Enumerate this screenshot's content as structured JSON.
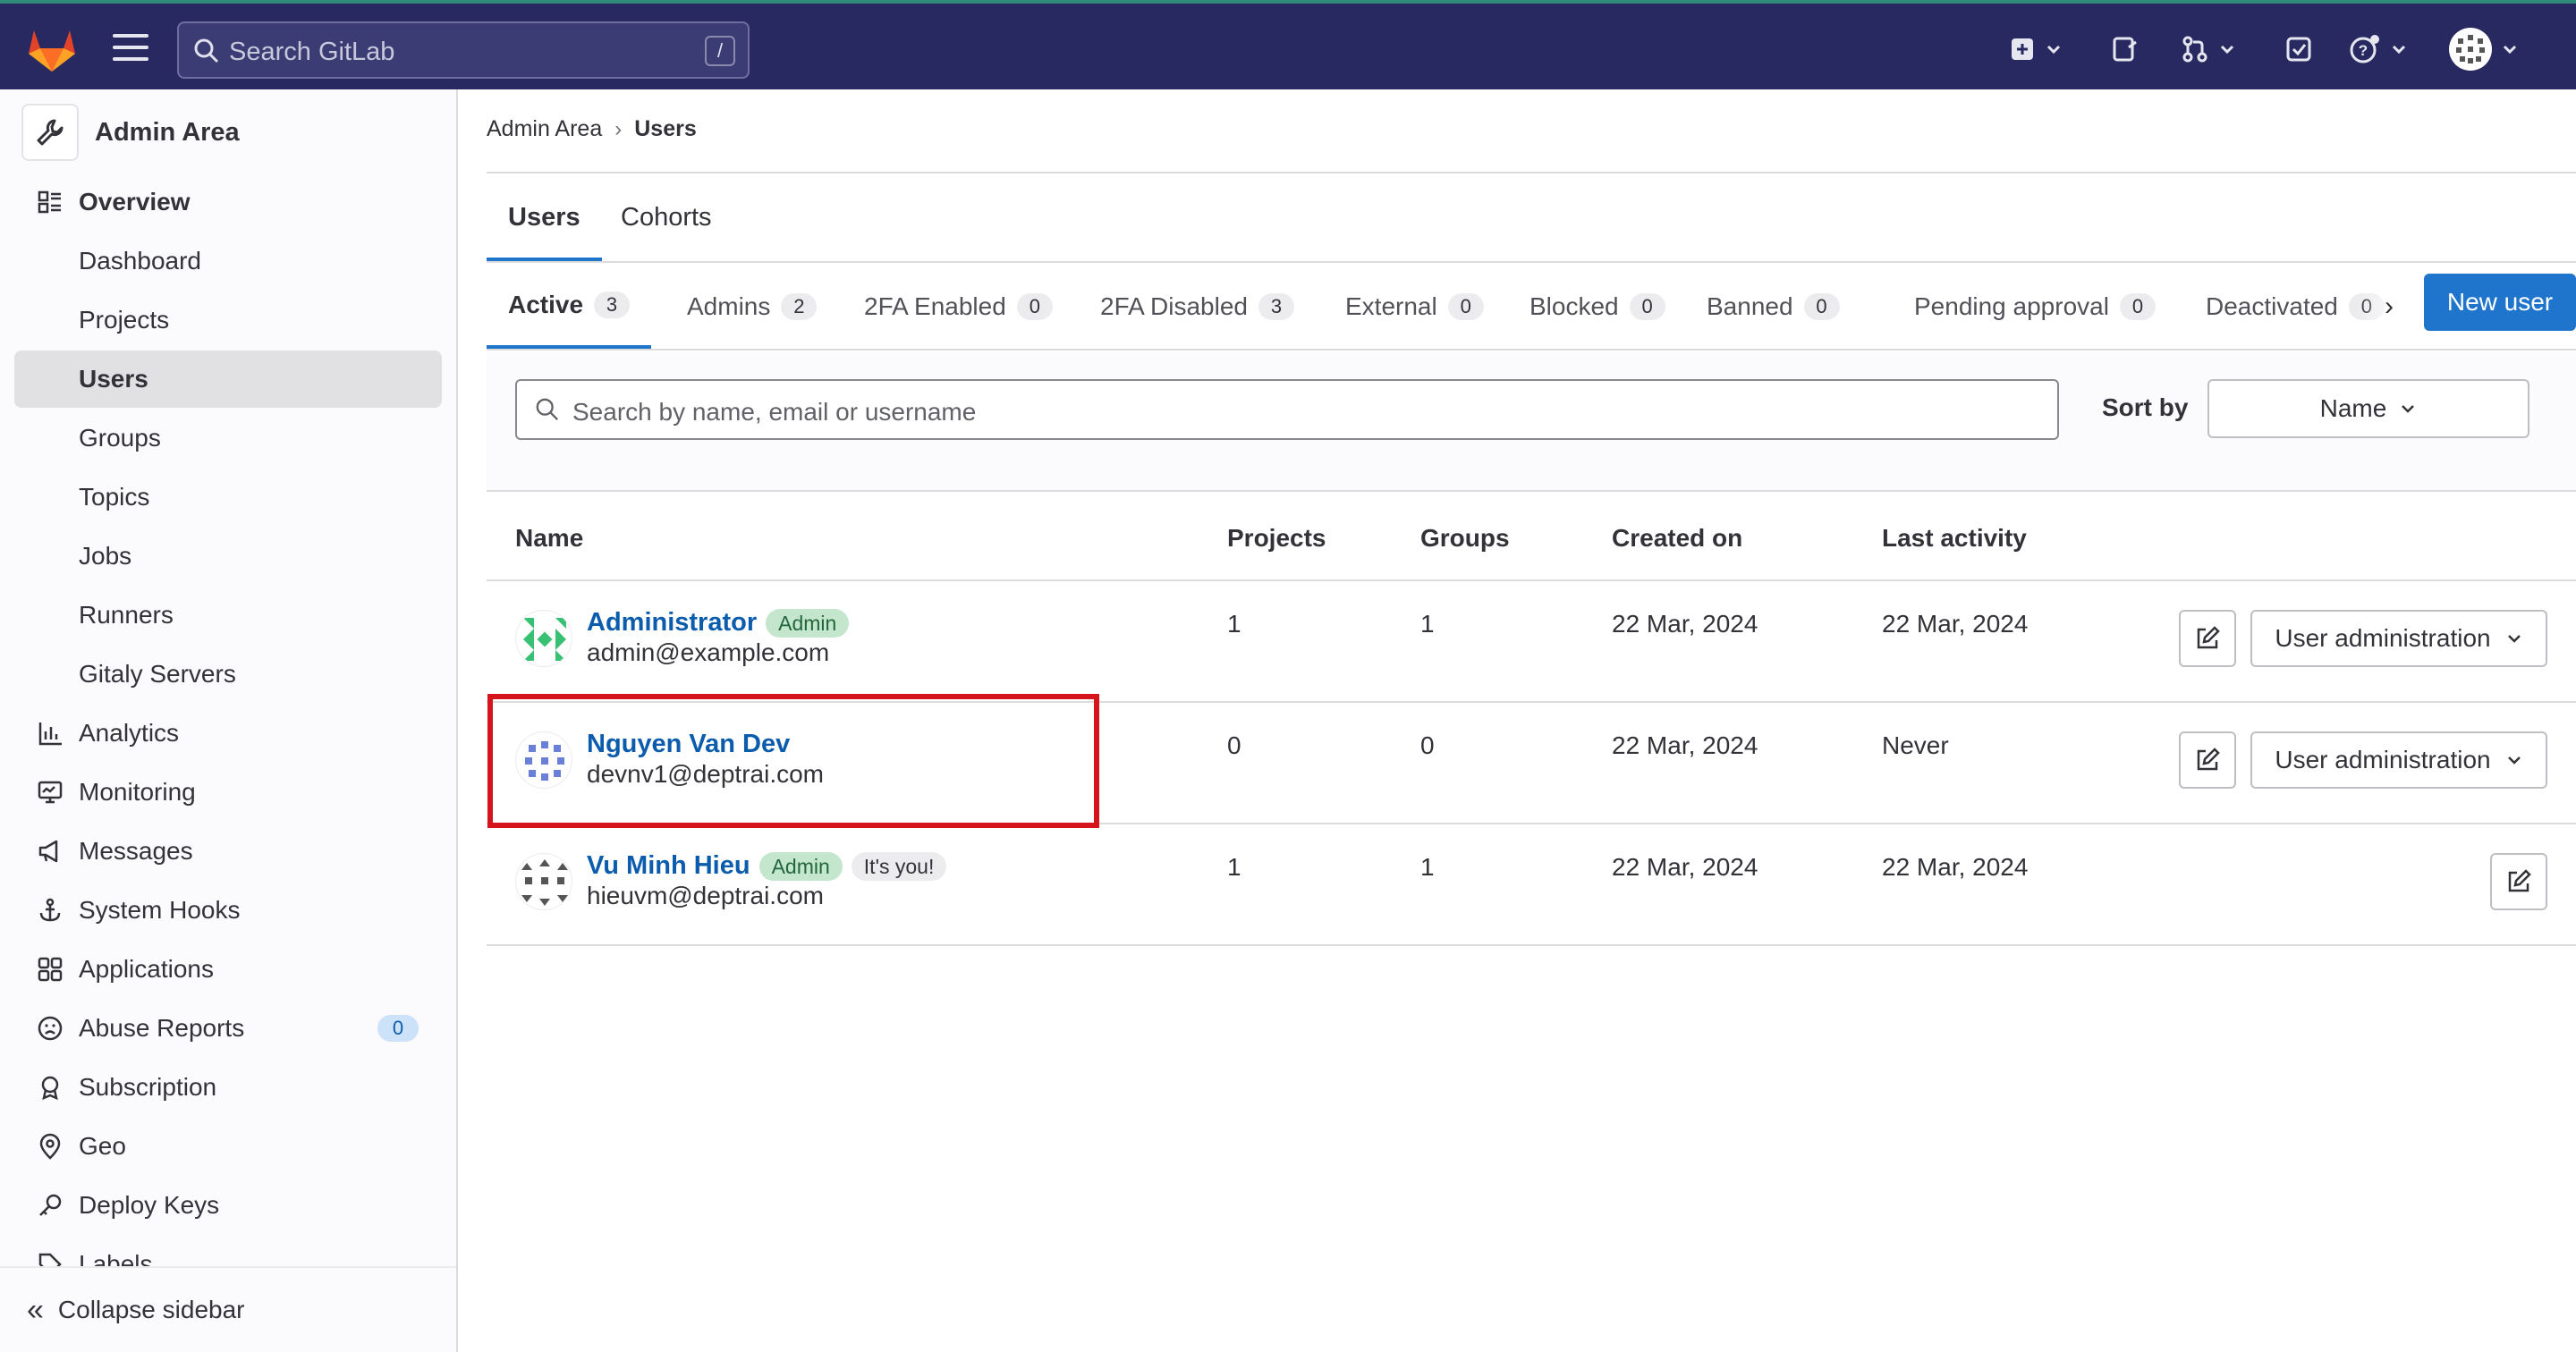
{
  "navbar": {
    "search_placeholder": "Search GitLab",
    "search_shortcut": "/",
    "icons": [
      "gitlab-logo",
      "hamburger-icon",
      "search-icon",
      "new-item-icon",
      "issues-icon",
      "merge-requests-icon",
      "todos-icon",
      "help-icon",
      "user-avatar"
    ]
  },
  "sidebar": {
    "title": "Admin Area",
    "items": [
      {
        "label": "Overview",
        "icon": "overview-icon"
      },
      {
        "label": "Dashboard"
      },
      {
        "label": "Projects"
      },
      {
        "label": "Users"
      },
      {
        "label": "Groups"
      },
      {
        "label": "Topics"
      },
      {
        "label": "Jobs"
      },
      {
        "label": "Runners"
      },
      {
        "label": "Gitaly Servers"
      },
      {
        "label": "Analytics",
        "icon": "analytics-icon"
      },
      {
        "label": "Monitoring",
        "icon": "monitoring-icon"
      },
      {
        "label": "Messages",
        "icon": "messages-icon"
      },
      {
        "label": "System Hooks",
        "icon": "hooks-icon"
      },
      {
        "label": "Applications",
        "icon": "applications-icon"
      },
      {
        "label": "Abuse Reports",
        "icon": "abuse-icon",
        "count": "0"
      },
      {
        "label": "Subscription",
        "icon": "subscription-icon"
      },
      {
        "label": "Geo",
        "icon": "geo-icon"
      },
      {
        "label": "Deploy Keys",
        "icon": "key-icon"
      },
      {
        "label": "Labels",
        "icon": "label-icon"
      }
    ],
    "collapse_label": "Collapse sidebar"
  },
  "breadcrumb": {
    "root": "Admin Area",
    "current": "Users"
  },
  "top_tabs": [
    "Users",
    "Cohorts"
  ],
  "filter_tabs": [
    {
      "label": "Active",
      "count": "3"
    },
    {
      "label": "Admins",
      "count": "2"
    },
    {
      "label": "2FA Enabled",
      "count": "0"
    },
    {
      "label": "2FA Disabled",
      "count": "3"
    },
    {
      "label": "External",
      "count": "0"
    },
    {
      "label": "Blocked",
      "count": "0"
    },
    {
      "label": "Banned",
      "count": "0"
    },
    {
      "label": "Pending approval",
      "count": "0"
    },
    {
      "label": "Deactivated",
      "count": "0"
    }
  ],
  "new_user_label": "New user",
  "search": {
    "placeholder": "Search by name, email or username",
    "sort_label": "Sort by",
    "sort_value": "Name"
  },
  "table": {
    "headers": [
      "Name",
      "Projects",
      "Groups",
      "Created on",
      "Last activity"
    ],
    "rows": [
      {
        "name": "Administrator",
        "badge": "Admin",
        "you": "",
        "email": "admin@example.com",
        "projects": "1",
        "groups": "1",
        "created": "22 Mar, 2024",
        "last": "22 Mar, 2024",
        "action": "User administration"
      },
      {
        "name": "Nguyen Van Dev",
        "badge": "",
        "you": "",
        "email": "devnv1@deptrai.com",
        "projects": "0",
        "groups": "0",
        "created": "22 Mar, 2024",
        "last": "Never",
        "action": "User administration"
      },
      {
        "name": "Vu Minh Hieu",
        "badge": "Admin",
        "you": "It's you!",
        "email": "hieuvm@deptrai.com",
        "projects": "1",
        "groups": "1",
        "created": "22 Mar, 2024",
        "last": "22 Mar, 2024",
        "action": ""
      }
    ]
  },
  "colors": {
    "navbar": "#292961",
    "link": "#0b5cad",
    "primary": "#1f75cb",
    "highlight": "#d6141c"
  }
}
